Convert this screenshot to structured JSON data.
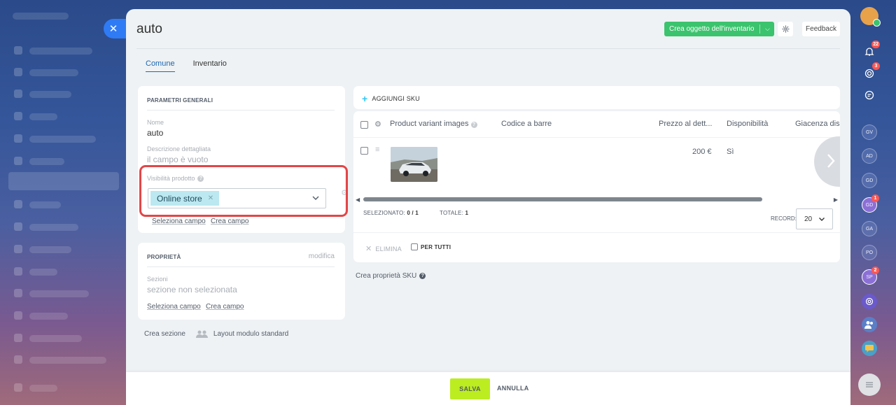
{
  "window": {
    "title": "auto"
  },
  "header": {
    "create_button": "Crea oggetto dell'inventario",
    "feedback_button": "Feedback"
  },
  "tabs": [
    {
      "label": "Comune",
      "active": true
    },
    {
      "label": "Inventario",
      "active": false
    }
  ],
  "general": {
    "section_title": "PARAMETRI GENERALI",
    "name_label": "Nome",
    "name_value": "auto",
    "description_label": "Descrizione dettagliata",
    "description_value": "il campo è vuoto",
    "visibility_label": "Visibilità prodotto",
    "visibility_tag": "Online store",
    "select_field_link": "Seleziona campo",
    "create_field_link": "Crea campo"
  },
  "properties": {
    "section_title": "PROPRIETÀ",
    "edit_link": "modifica",
    "sections_label": "Sezioni",
    "sections_value": "sezione non selezionata",
    "select_field_link": "Seleziona campo",
    "create_field_link": "Crea campo"
  },
  "bottom_links": {
    "create_section": "Crea sezione",
    "layout": "Layout modulo standard"
  },
  "sku": {
    "add_sku": "AGGIUNGI SKU",
    "columns": [
      "Product variant images",
      "Codice a barre",
      "Prezzo al dett...",
      "Disponibilità",
      "Giacenza disp"
    ],
    "row": {
      "price": "200 €",
      "availability": "Sì"
    },
    "selected_label": "SELEZIONATO:",
    "selected_value": "0 / 1",
    "total_label": "TOTALE:",
    "total_value": "1",
    "records_label": "RECORD:",
    "records_value": "20",
    "delete_label": "ELIMINA",
    "for_all_label": "PER TUTTI",
    "create_sku_property": "Crea proprietà SKU"
  },
  "footer": {
    "save": "SALVA",
    "cancel": "ANNULLA"
  },
  "rail": {
    "notifications_badge": "22",
    "second_badge": "3",
    "avatars": [
      "GV",
      "AD",
      "GD",
      "GD",
      "GA",
      "PO",
      "SP"
    ],
    "gd_badge": "1",
    "sp_badge": "2"
  },
  "colors": {
    "accent_green": "#3bc36d",
    "save_green": "#bbed21",
    "link_blue": "#2067b0",
    "tag_bg": "#bce8f1",
    "highlight_red": "#e24648",
    "close_blue": "#2f7bf5"
  }
}
